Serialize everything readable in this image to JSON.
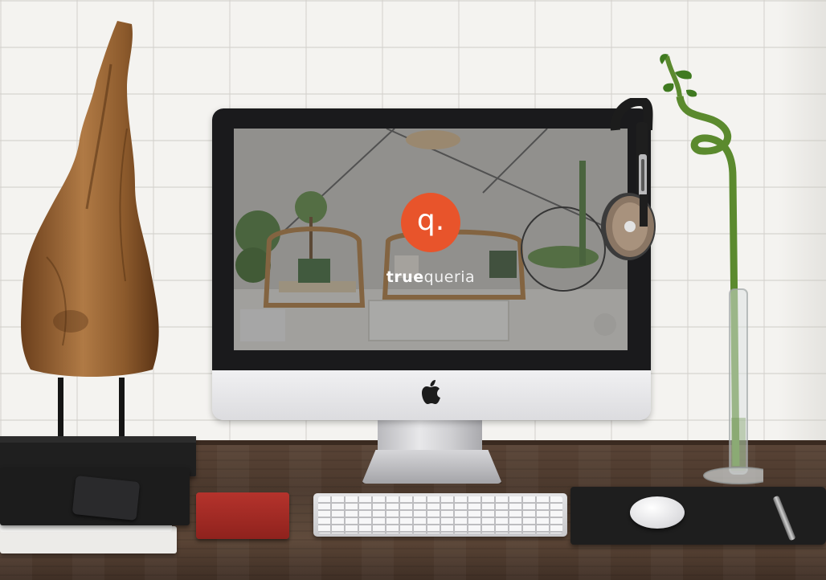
{
  "screen": {
    "brand_mark": "q.",
    "brand_name_bold": "true",
    "brand_name_light": "queria"
  },
  "colors": {
    "brand_orange": "#e8542b",
    "desk_wood": "#4a382c",
    "wall": "#f4f3f0",
    "imac_bezel": "#1a1a1c"
  },
  "icons": {
    "monitor_logo": "apple-icon"
  }
}
